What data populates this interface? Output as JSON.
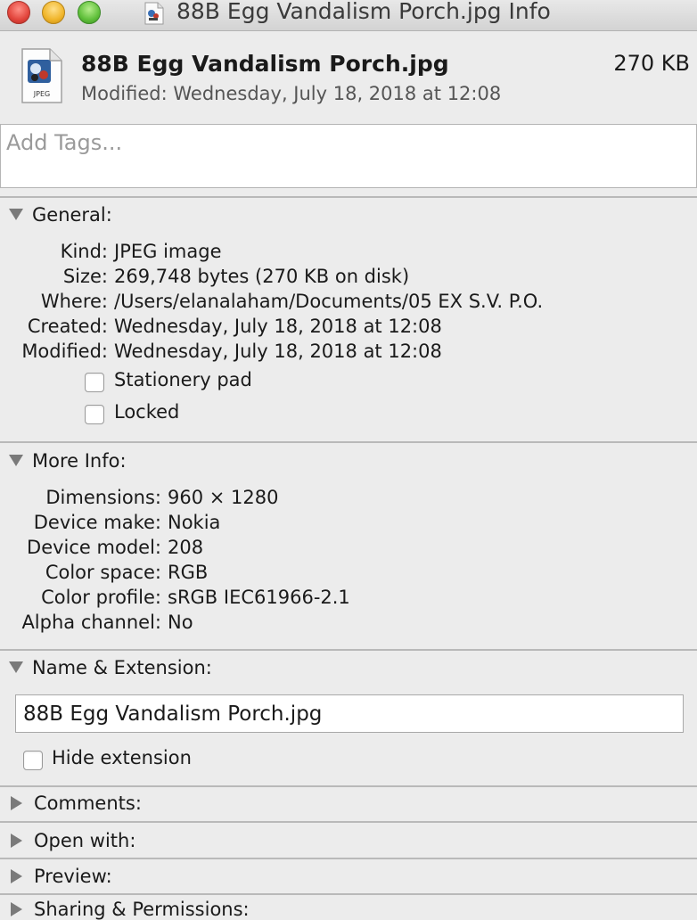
{
  "window": {
    "title": "88B Egg Vandalism Porch.jpg Info",
    "title_icon": "jpeg-file-icon"
  },
  "header": {
    "file_name": "88B Egg Vandalism Porch.jpg",
    "file_size": "270 KB",
    "modified": "Modified: Wednesday, July 18, 2018 at 12:08",
    "icon_badge": "JPEG"
  },
  "tags": {
    "placeholder": "Add Tags..."
  },
  "general": {
    "title": "General:",
    "rows": [
      {
        "label": "Kind:",
        "value": "JPEG image"
      },
      {
        "label": "Size:",
        "value": "269,748 bytes (270 KB on disk)"
      },
      {
        "label": "Where:",
        "value": "/Users/elanalaham/Documents/05 EX S.V. P.O."
      },
      {
        "label": "Created:",
        "value": "Wednesday, July 18, 2018 at 12:08"
      },
      {
        "label": "Modified:",
        "value": "Wednesday, July 18, 2018 at 12:08"
      }
    ],
    "stationery_label": "Stationery pad",
    "locked_label": "Locked"
  },
  "more_info": {
    "title": "More Info:",
    "rows": [
      {
        "label": "Dimensions:",
        "value": "960 × 1280"
      },
      {
        "label": "Device make:",
        "value": "Nokia"
      },
      {
        "label": "Device model:",
        "value": "208"
      },
      {
        "label": "Color space:",
        "value": "RGB"
      },
      {
        "label": "Color profile:",
        "value": "sRGB IEC61966-2.1"
      },
      {
        "label": "Alpha channel:",
        "value": "No"
      }
    ]
  },
  "name_extension": {
    "title": "Name & Extension:",
    "value": "88B Egg Vandalism Porch.jpg",
    "hide_extension_label": "Hide extension"
  },
  "comments": {
    "title": "Comments:"
  },
  "open_with": {
    "title": "Open with:"
  },
  "preview": {
    "title": "Preview:"
  },
  "sharing": {
    "title": "Sharing & Permissions:"
  }
}
